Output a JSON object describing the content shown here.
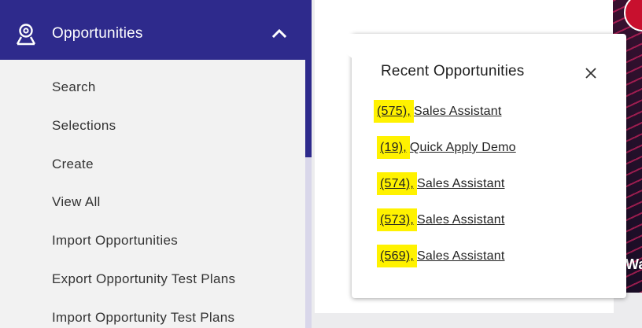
{
  "sidebar": {
    "header": {
      "label": "Opportunities",
      "icon": "user-badge-icon",
      "expand_icon": "chevron-up-icon"
    },
    "items": [
      {
        "label": "Search"
      },
      {
        "label": "Selections"
      },
      {
        "label": "Create"
      },
      {
        "label": "View All"
      },
      {
        "label": "Import Opportunities"
      },
      {
        "label": "Export Opportunity Test Plans"
      },
      {
        "label": "Import Opportunity Test Plans"
      }
    ]
  },
  "popover": {
    "title": "Recent Opportunities",
    "close_icon": "close-icon",
    "items": [
      {
        "id": "(575),",
        "name": "Sales Assistant"
      },
      {
        "id": "(19),",
        "name": "Quick Apply Demo"
      },
      {
        "id": "(574),",
        "name": "Sales Assistant"
      },
      {
        "id": "(573),",
        "name": "Sales Assistant"
      },
      {
        "id": "(569),",
        "name": "Sales Assistant"
      }
    ]
  },
  "banner": {
    "text": "Wa"
  },
  "colors": {
    "sidebar_header": "#2e2a8c",
    "highlight": "#fff200",
    "sidebar_bg": "#f2f2f2"
  }
}
